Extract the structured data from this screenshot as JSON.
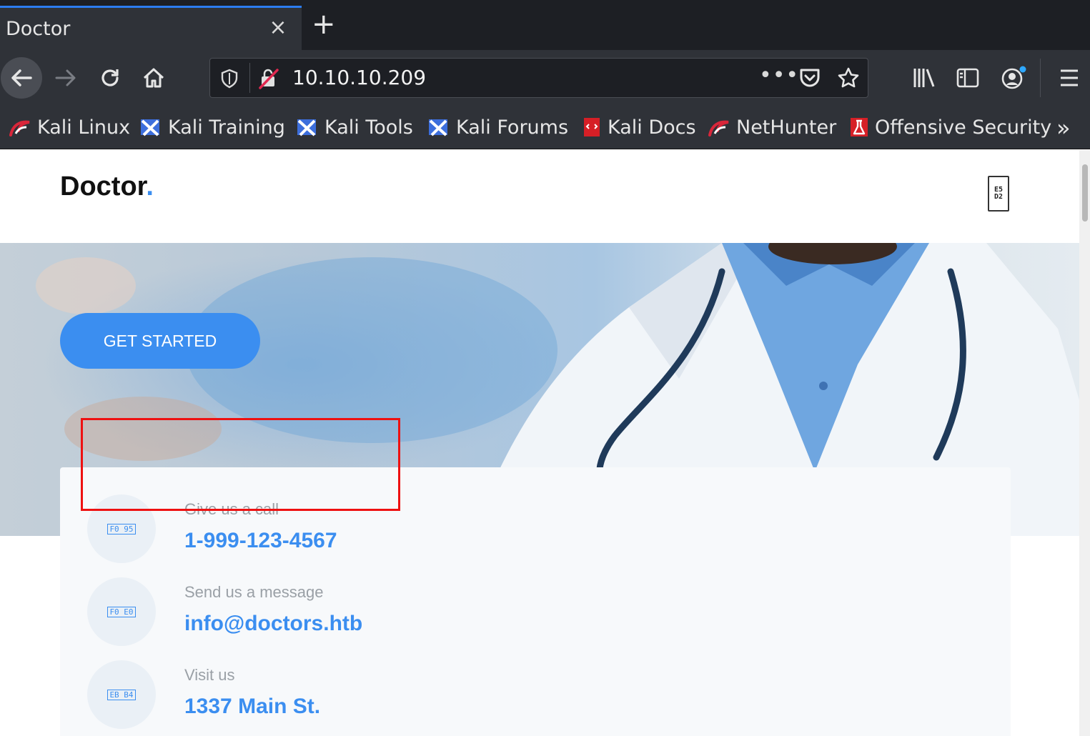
{
  "browser": {
    "tab_title": "Doctor",
    "tab_close": "×",
    "new_tab": "+",
    "url": "10.10.10.209",
    "url_more": "•••",
    "bookmarks": [
      {
        "label": "Kali Linux",
        "icon": "kali-dragon-icon"
      },
      {
        "label": "Kali Training",
        "icon": "kali-training-icon"
      },
      {
        "label": "Kali Tools",
        "icon": "kali-tools-icon"
      },
      {
        "label": "Kali Forums",
        "icon": "kali-forums-icon"
      },
      {
        "label": "Kali Docs",
        "icon": "kali-docs-icon"
      },
      {
        "label": "NetHunter",
        "icon": "nethunter-icon"
      },
      {
        "label": "Offensive Security",
        "icon": "offsec-icon"
      }
    ],
    "bookmarks_overflow": "»"
  },
  "site": {
    "brand": "Doctor",
    "brand_dot": ".",
    "menu_toggle_glyph": "E5 D2",
    "hero_cta": "GET STARTED",
    "contacts": [
      {
        "label": "Give us a call",
        "value": "1-999-123-4567",
        "icon_glyph": "F0 95",
        "icon": "phone-icon"
      },
      {
        "label": "Send us a message",
        "value": "info@doctors.htb",
        "icon_glyph": "F0 E0",
        "icon": "envelope-icon"
      },
      {
        "label": "Visit us",
        "value": "1337 Main St.",
        "icon_glyph": "EB B4",
        "icon": "map-marker-icon"
      }
    ]
  },
  "colors": {
    "accent": "#3b8ef0",
    "chrome_dark": "#1d1f24",
    "chrome": "#2f3238",
    "highlight": "#e11111"
  }
}
